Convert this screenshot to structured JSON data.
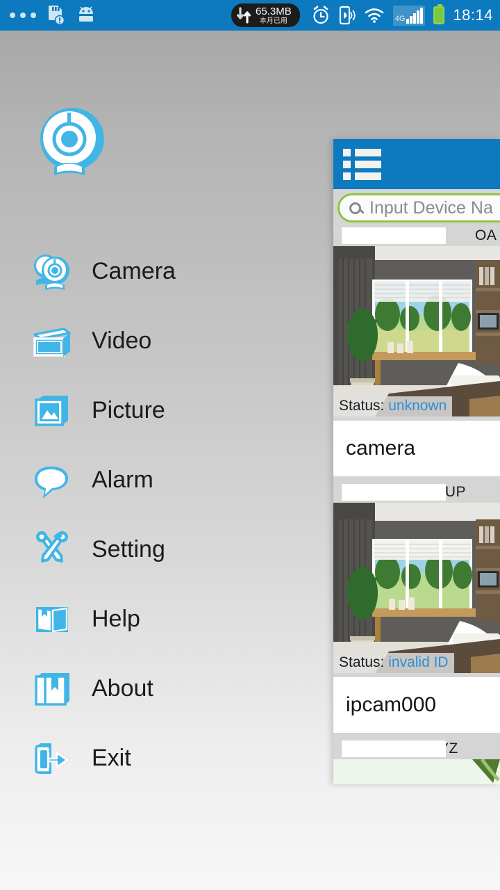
{
  "statusbar": {
    "left_icons": [
      "more-dots",
      "sdcard-warning",
      "android-robot"
    ],
    "data_badge": {
      "amount": "65.3MB",
      "note": "本月已用",
      "icon": "data-transfer-arrows"
    },
    "right_icons": [
      "alarm-clock",
      "phone-vibrate",
      "wifi",
      "signal-4g",
      "battery"
    ],
    "network_label": "4G",
    "time": "18:14",
    "bg_color": "#0d79bf"
  },
  "drawer": {
    "logo_name": "webcam-logo",
    "items": [
      {
        "label": "Camera",
        "icon": "cameras-icon"
      },
      {
        "label": "Video",
        "icon": "video-clapper-icon"
      },
      {
        "label": "Picture",
        "icon": "picture-icon"
      },
      {
        "label": "Alarm",
        "icon": "speech-bubble-icon"
      },
      {
        "label": "Setting",
        "icon": "tools-icon"
      },
      {
        "label": "Help",
        "icon": "open-book-icon"
      },
      {
        "label": "About",
        "icon": "closed-book-icon"
      },
      {
        "label": "Exit",
        "icon": "exit-arrow-icon"
      }
    ]
  },
  "panel": {
    "header_icon": "list-menu-icon",
    "search": {
      "placeholder": "Input Device Na",
      "icon": "search-icon",
      "border_color": "#8cc63f"
    },
    "status_label": "Status:",
    "devices": [
      {
        "id_text": "OA",
        "status": "unknown",
        "name": "camera",
        "thumbnail": "living-room-window-scene"
      },
      {
        "id_text": "GUP",
        "status": "invalid ID",
        "name": "ipcam000",
        "thumbnail": "living-room-window-scene"
      },
      {
        "id_text": "YZ",
        "status": "",
        "name": "",
        "thumbnail": "living-room-window-scene"
      }
    ]
  },
  "colors": {
    "accent_blue": "#0d79bf",
    "icon_blue": "#41b6e6",
    "status_blue": "#2f8fd6",
    "search_green": "#8cc63f",
    "battery_green": "#7ac943"
  }
}
